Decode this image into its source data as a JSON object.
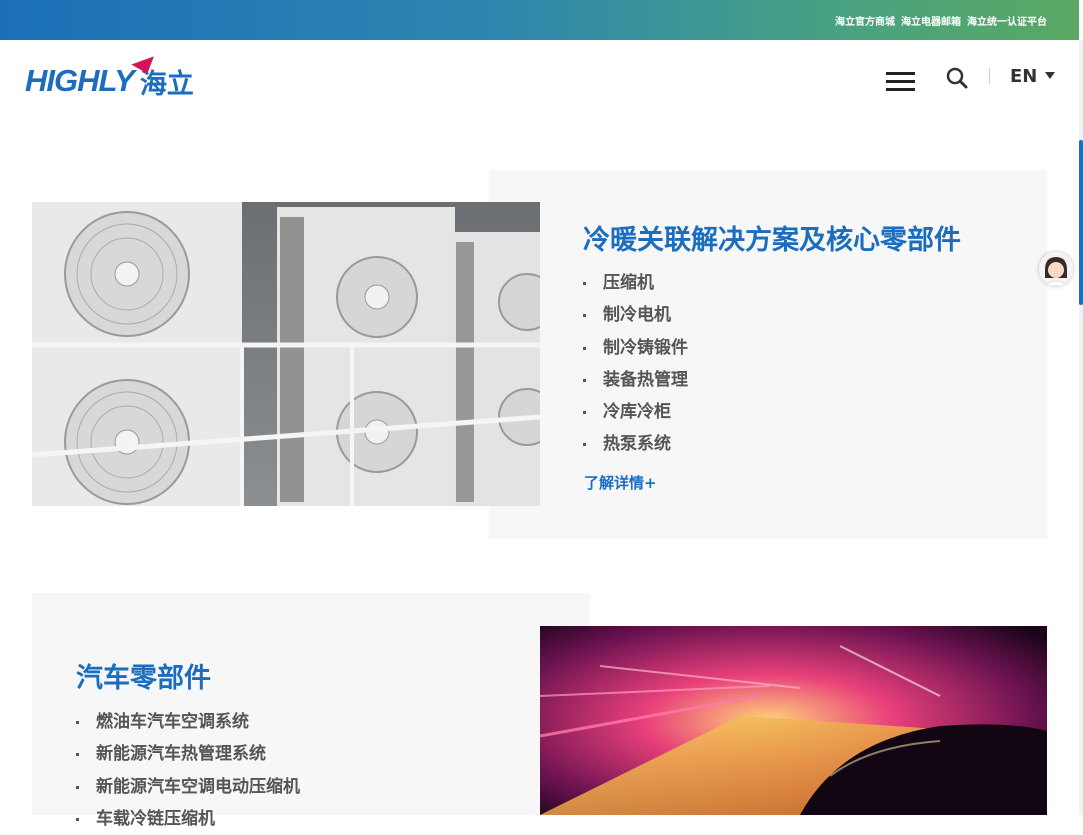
{
  "top_links": [
    "海立官方商城",
    "海立电器邮箱",
    "海立统一认证平台"
  ],
  "logo": {
    "en": "HIGHLY",
    "cn": "海立"
  },
  "header": {
    "lang": "EN"
  },
  "section1": {
    "title": "冷暖关联解决方案及核心零部件",
    "items": [
      "压缩机",
      "制冷电机",
      "制冷铸锻件",
      "装备热管理",
      "冷库冷柜",
      "热泵系统"
    ],
    "more": "了解详情+"
  },
  "section2": {
    "title": "汽车零部件",
    "items": [
      "燃油车汽车空调系统",
      "新能源汽车热管理系统",
      "新能源汽车空调电动压缩机",
      "车载冷链压缩机"
    ]
  },
  "colors": {
    "brand": "#1b6dbf",
    "accent": "#d4145a"
  }
}
